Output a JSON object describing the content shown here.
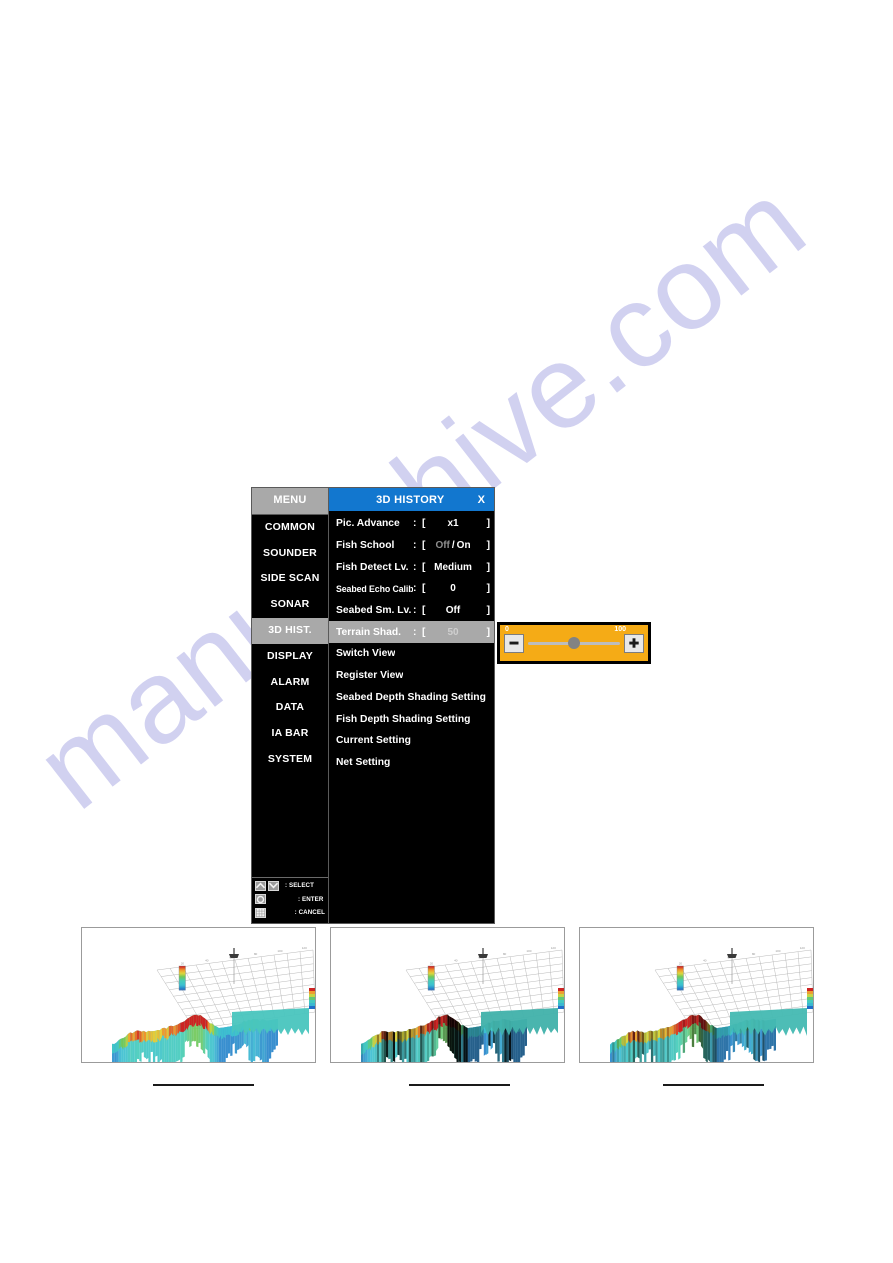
{
  "page": {
    "watermark_text": "manualshive.com",
    "background_color": "#ffffff"
  },
  "device_screen": {
    "nav": {
      "header_label": "MENU",
      "items": [
        {
          "label": "COMMON",
          "active": false
        },
        {
          "label": "SOUNDER",
          "active": false
        },
        {
          "label": "SIDE SCAN",
          "active": false
        },
        {
          "label": "SONAR",
          "active": false
        },
        {
          "label": "3D HIST.",
          "active": true
        },
        {
          "label": "DISPLAY",
          "active": false
        },
        {
          "label": "ALARM",
          "active": false
        },
        {
          "label": "DATA",
          "active": false
        },
        {
          "label": "IA BAR",
          "active": false
        },
        {
          "label": "SYSTEM",
          "active": false
        }
      ]
    },
    "key_legend": [
      {
        "icon": "chevron-up-icon",
        "icon2": "chevron-down-icon",
        "label": ": SELECT"
      },
      {
        "icon": "circle-button-icon",
        "label": ": ENTER"
      },
      {
        "icon": "grid-keypad-icon",
        "label": ": CANCEL"
      }
    ],
    "panel": {
      "title": "3D HISTORY",
      "close_label": "X",
      "title_bg_color": "#1277cf",
      "selected_row_bg_color": "#a9a9a9",
      "rows": [
        {
          "label": "Pic. Advance",
          "colon": ":",
          "bracket_l": "[",
          "value": "x1",
          "bracket_r": "]",
          "type": "value",
          "selected": false,
          "small_label": false
        },
        {
          "label": "Fish School",
          "colon": ":",
          "bracket_l": "[",
          "value_off": "Off",
          "value_sep": "/",
          "value_on": "On",
          "bracket_r": "]",
          "type": "toggle",
          "selected": false,
          "small_label": false
        },
        {
          "label": "Fish Detect Lv.",
          "colon": ":",
          "bracket_l": "[",
          "value": "Medium",
          "bracket_r": "]",
          "type": "value",
          "selected": false,
          "small_label": false
        },
        {
          "label": "Seabed Echo Calib.",
          "colon": ":",
          "bracket_l": "[",
          "value": "0",
          "bracket_r": "]",
          "type": "value",
          "selected": false,
          "small_label": true
        },
        {
          "label": "Seabed Sm. Lv.",
          "colon": ":",
          "bracket_l": "[",
          "value": "Off",
          "bracket_r": "]",
          "type": "value",
          "selected": false,
          "small_label": false
        },
        {
          "label": "Terrain Shad.",
          "colon": ":",
          "bracket_l": "[",
          "value": "50",
          "bracket_r": "]",
          "type": "value",
          "selected": true,
          "small_label": false
        },
        {
          "label": "Switch View",
          "type": "plain",
          "selected": false
        },
        {
          "label": "Register View",
          "type": "plain",
          "selected": false
        },
        {
          "label": "Seabed Depth Shading Setting",
          "type": "plain",
          "selected": false
        },
        {
          "label": "Fish Depth Shading Setting",
          "type": "plain",
          "selected": false
        },
        {
          "label": "Current Setting",
          "type": "plain",
          "selected": false
        },
        {
          "label": "Net Setting",
          "type": "plain",
          "selected": false
        }
      ]
    }
  },
  "slider_popup": {
    "min_label": "0",
    "max_label": "100",
    "value": 50,
    "minimum": 0,
    "maximum": 100,
    "decrement_icon": "minus-icon",
    "increment_icon": "plus-icon",
    "background_color": "#f5ab16",
    "knob_color": "#838383"
  },
  "thumbnails": [
    {
      "name": "3d-terrain-view-1",
      "shading": "none",
      "caption": ""
    },
    {
      "name": "3d-terrain-view-2",
      "shading": "strong",
      "caption": ""
    },
    {
      "name": "3d-terrain-view-3",
      "shading": "medium",
      "caption": ""
    }
  ]
}
